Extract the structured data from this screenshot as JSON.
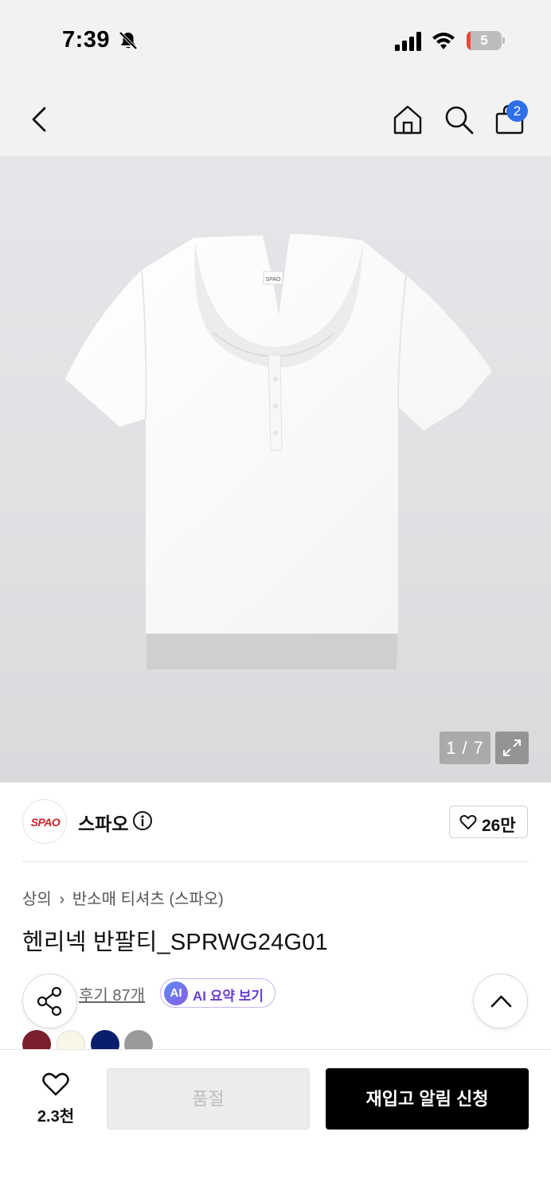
{
  "status_bar": {
    "time": "7:39",
    "battery_level": "5",
    "icons": [
      "bell-slash-icon",
      "cellular-signal-icon",
      "wifi-icon",
      "battery-icon"
    ]
  },
  "nav": {
    "icons": [
      "chevron-left-icon",
      "home-icon",
      "search-icon",
      "shopping-bag-icon"
    ],
    "cart_count": "2"
  },
  "gallery": {
    "counter": "1 / 7",
    "tag_text": "SPAO"
  },
  "brand": {
    "logo_text": "SPAO",
    "name": "스파오",
    "likes": "26만"
  },
  "breadcrumb": {
    "items": [
      "상의",
      "반소매 티셔츠 (스파오)"
    ]
  },
  "product": {
    "title": "헨리넥 반팔티_SPRWG24G01",
    "review_link": "후기 87개",
    "ai_badge": "AI",
    "ai_summary": "AI 요약 보기",
    "swatches": [
      "#7a1f2b",
      "#f8f6e6",
      "#0a1f6b",
      "#9a9a9a"
    ]
  },
  "bottom_bar": {
    "wish_count": "2.3천",
    "soldout_label": "품절",
    "restock_label": "재입고 알림 신청"
  },
  "colors": {
    "badge_blue": "#2f6fe8",
    "brand_red": "#d0202a",
    "ai_purple": "#6a3fd1"
  }
}
